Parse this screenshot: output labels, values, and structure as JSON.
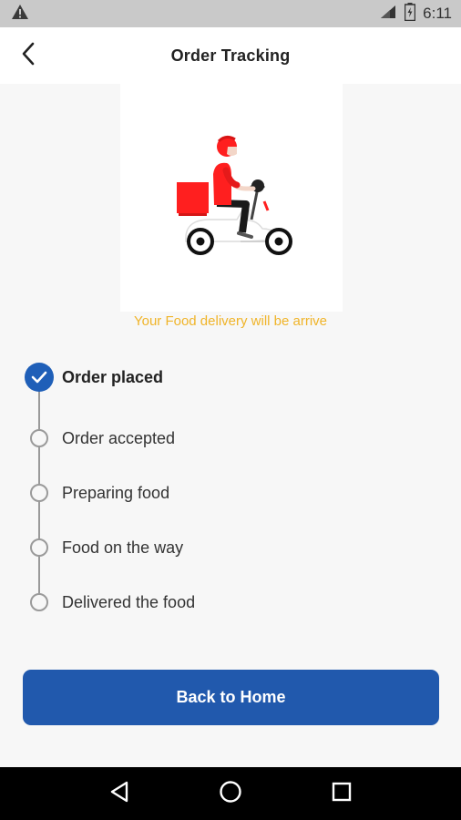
{
  "status_bar": {
    "time": "6:11",
    "icons": [
      "warning-icon",
      "signal-icon",
      "battery-icon"
    ]
  },
  "header": {
    "title": "Order Tracking",
    "back_icon": "back-arrow-icon"
  },
  "hero": {
    "illustration": "delivery-scooter-illustration",
    "message": "Your Food delivery will be arrive"
  },
  "tracking": {
    "steps": [
      {
        "label": "Order placed",
        "done": true
      },
      {
        "label": "Order accepted",
        "done": false
      },
      {
        "label": "Preparing food",
        "done": false
      },
      {
        "label": "Food on the way",
        "done": false
      },
      {
        "label": "Delivered the food",
        "done": false
      }
    ]
  },
  "actions": {
    "home_label": "Back to Home"
  },
  "navigation": {
    "buttons": [
      "nav-back-icon",
      "nav-home-icon",
      "nav-recents-icon"
    ]
  },
  "colors": {
    "primary": "#2159ad",
    "check": "#1f5fb8",
    "accent": "#f0b429",
    "illustration_red": "#ff1f1f"
  }
}
